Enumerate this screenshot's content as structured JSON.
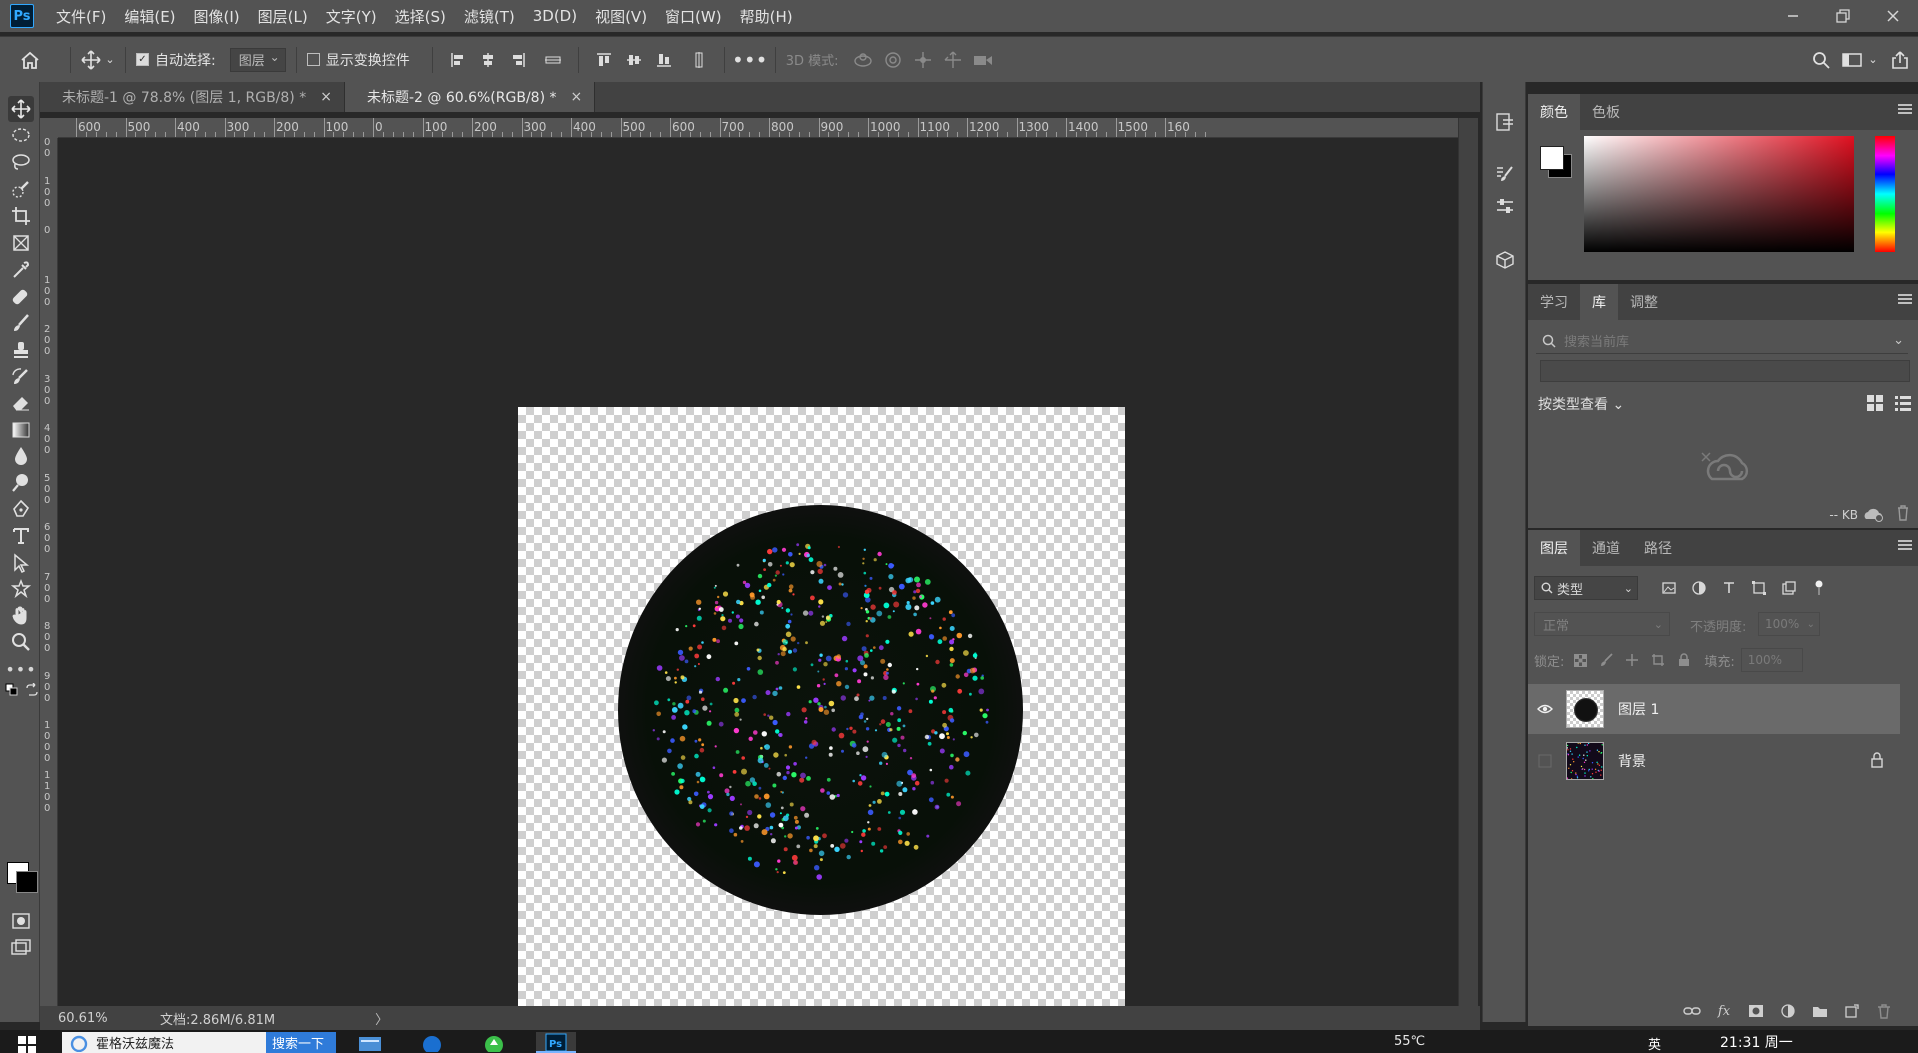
{
  "app": {
    "logo": "Ps",
    "menu": [
      "文件(F)",
      "编辑(E)",
      "图像(I)",
      "图层(L)",
      "文字(Y)",
      "选择(S)",
      "滤镜(T)",
      "3D(D)",
      "视图(V)",
      "窗口(W)",
      "帮助(H)"
    ]
  },
  "options": {
    "auto_select_label": "自动选择:",
    "auto_select_value": "图层",
    "show_transform_label": "显示变换控件",
    "mode_3d_label": "3D 模式:"
  },
  "tabs": [
    {
      "label": "未标题-1 @ 78.8% (图层 1, RGB/8) *",
      "close": "×"
    },
    {
      "label": "未标题-2 @ 60.6%(RGB/8) *",
      "close": "×"
    }
  ],
  "ruler": {
    "h_labels": [
      "600",
      "500",
      "400",
      "300",
      "200",
      "100",
      "0",
      "100",
      "200",
      "300",
      "400",
      "500",
      "600",
      "700",
      "800",
      "900",
      "1000",
      "1100",
      "1200",
      "1300",
      "1400",
      "1500",
      "160"
    ],
    "v_labels": [
      "200",
      "100",
      "0",
      "100",
      "200",
      "300",
      "400",
      "500",
      "600",
      "700",
      "800",
      "900",
      "1000",
      "1100"
    ]
  },
  "status": {
    "zoom": "60.61%",
    "doc": "文档:2.86M/6.81M",
    "arrow": "〉"
  },
  "color_panel": {
    "tabs": [
      "颜色",
      "色板"
    ]
  },
  "library_panel": {
    "tabs": [
      "学习",
      "库",
      "调整"
    ],
    "search_placeholder": "搜索当前库",
    "view_by": "按类型查看",
    "size": "-- KB"
  },
  "layers_panel": {
    "tabs": [
      "图层",
      "通道",
      "路径"
    ],
    "filter": "类型",
    "blend_mode": "正常",
    "opacity_label": "不透明度:",
    "opacity_value": "100%",
    "lock_label": "锁定:",
    "fill_label": "填充:",
    "fill_value": "100%",
    "layers": [
      {
        "name": "图层 1",
        "visible": true,
        "selected": true
      },
      {
        "name": "背景",
        "visible": false,
        "selected": false,
        "locked": true
      }
    ]
  },
  "taskbar": {
    "search_text": "霍格沃兹魔法",
    "search_button": "搜索一下",
    "temperature": "55℃",
    "ime": "英",
    "time": "21:31 周一"
  },
  "colors": {
    "accent": "#31a8ff",
    "panel_bg": "#535353",
    "workspace_bg": "#282828"
  }
}
